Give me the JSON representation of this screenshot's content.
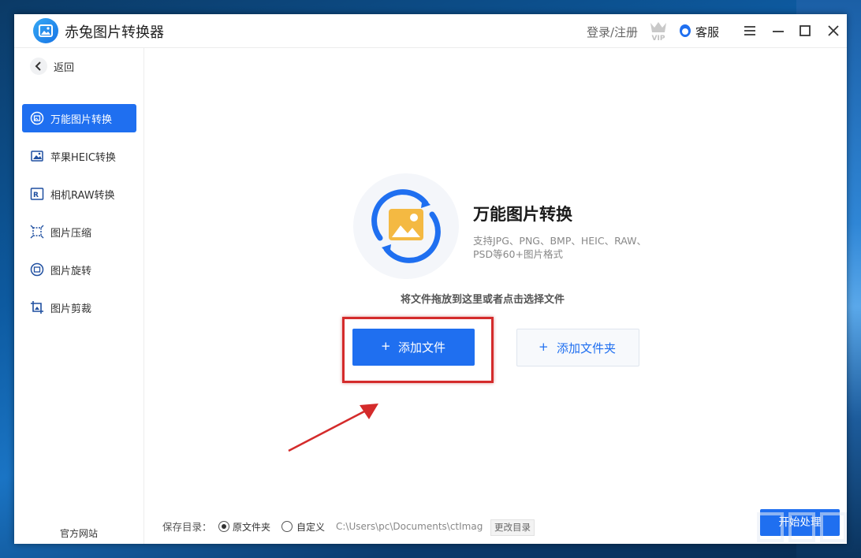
{
  "app": {
    "title": "赤兔图片转换器"
  },
  "header": {
    "login_label": "登录/注册",
    "vip_label": "VIP",
    "service_label": "客服"
  },
  "sidebar": {
    "back_label": "返回",
    "items": [
      {
        "label": "万能图片转换",
        "icon": "image-convert-icon",
        "active": true
      },
      {
        "label": "苹果HEIC转换",
        "icon": "heic-icon",
        "active": false
      },
      {
        "label": "相机RAW转换",
        "icon": "raw-icon",
        "active": false
      },
      {
        "label": "图片压缩",
        "icon": "compress-icon",
        "active": false
      },
      {
        "label": "图片旋转",
        "icon": "rotate-icon",
        "active": false
      },
      {
        "label": "图片剪裁",
        "icon": "crop-icon",
        "active": false
      }
    ],
    "official_site": "官方网站"
  },
  "main": {
    "title": "万能图片转换",
    "description": "支持JPG、PNG、BMP、HEIC、RAW、PSD等60+图片格式",
    "drop_hint": "将文件拖放到这里或者点击选择文件",
    "add_file_label": "添加文件",
    "add_folder_label": "添加文件夹",
    "plus": "+"
  },
  "footer": {
    "save_dir_label": "保存目录：",
    "option_original": "原文件夹",
    "option_custom": "自定义",
    "selected": "原文件夹",
    "path": "C:\\Users\\pc\\Documents\\ctImag",
    "change_dir_label": "更改目录",
    "start_label": "开始处理"
  },
  "colors": {
    "accent": "#1f6ff0",
    "highlight": "#d42b2b",
    "hero_icon_bg": "#f4b942"
  }
}
